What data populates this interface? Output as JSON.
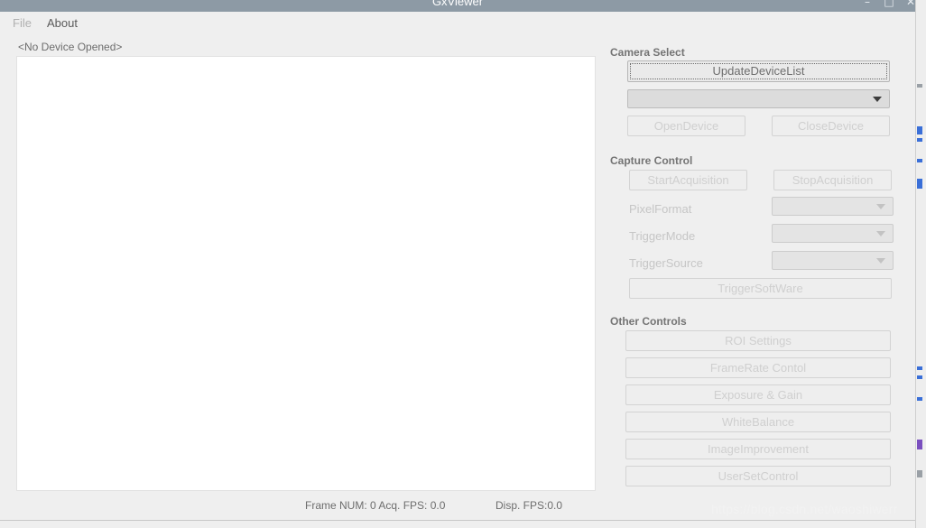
{
  "window": {
    "title": "GxViewer",
    "controls": {
      "minimize": "–",
      "maximize": "□",
      "close": "✕"
    }
  },
  "menu": {
    "items": [
      {
        "label": "File",
        "enabled": false
      },
      {
        "label": "About",
        "enabled": true
      }
    ]
  },
  "display": {
    "device_status": "<No Device Opened>"
  },
  "status_bar": {
    "frames_text": "Frame NUM: 0   Acq. FPS: 0.0",
    "display_fps_text": "Disp. FPS:0.0",
    "watermark": "https://blog.csdn.net/waoshiwerr"
  },
  "panel": {
    "camera_select": {
      "title": "Camera Select",
      "update_device_list": "UpdateDeviceList",
      "device_combo_value": "",
      "open_device": "OpenDevice",
      "close_device": "CloseDevice"
    },
    "capture_control": {
      "title": "Capture Control",
      "start_acquisition": "StartAcquisition",
      "stop_acquisition": "StopAcquisition",
      "pixel_format_label": "PixelFormat",
      "pixel_format_value": "",
      "trigger_mode_label": "TriggerMode",
      "trigger_mode_value": "",
      "trigger_source_label": "TriggerSource",
      "trigger_source_value": "",
      "trigger_software": "TriggerSoftWare"
    },
    "other_controls": {
      "title": "Other Controls",
      "roi_settings": "ROI Settings",
      "framerate_control": "FrameRate Contol",
      "exposure_gain": "Exposure & Gain",
      "white_balance": "WhiteBalance",
      "image_improvement": "ImageImprovement",
      "user_set_control": "UserSetControl"
    }
  },
  "colors": {
    "titlebar": "#8d9aa5",
    "window_bg": "#efefef",
    "display_bg": "#ffffff",
    "disabled_text": "#cfcfcf",
    "label_text": "#6d6d6d",
    "group_title": "#747474"
  }
}
